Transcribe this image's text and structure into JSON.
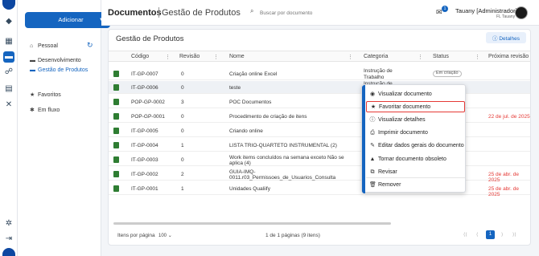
{
  "header": {
    "title": "Documentos",
    "subtitle": "Gestão de Produtos",
    "search_placeholder": "Buscar por documento",
    "notif_count": "1",
    "user_name": "Tauany [Administrador]",
    "user_role": "FL Tauany"
  },
  "sidebar": {
    "add_label": "Adicionar",
    "pessoal": "Pessoal",
    "desenvolvimento": "Desenvolvimento",
    "gestao": "Gestão de Produtos",
    "favoritos": "Favoritos",
    "fluxo": "Em fluxo"
  },
  "panel": {
    "title": "Gestão de Produtos",
    "details_label": "Detalhes"
  },
  "table": {
    "columns": [
      "Código",
      "Revisão",
      "Nome",
      "Categoria",
      "Status",
      "Próxima revisão"
    ],
    "rows": [
      {
        "code": "IT-GP-0007",
        "rev": "0",
        "name": "Criação online Excel",
        "name2": "",
        "cat": "Instrução de",
        "cat2": "Trabalho",
        "status": "Em criação",
        "next": ""
      },
      {
        "code": "IT-GP-0006",
        "rev": "0",
        "name": "teste",
        "name2": "",
        "cat": "Instrução de",
        "cat2": "",
        "status": "",
        "next": ""
      },
      {
        "code": "POP-GP-0002",
        "rev": "3",
        "name": "POC Documentos",
        "name2": "",
        "cat": "",
        "cat2": "",
        "status": "",
        "next": ""
      },
      {
        "code": "POP-GP-0001",
        "rev": "0",
        "name": "Procedimento de criação de itens",
        "name2": "",
        "cat": "",
        "cat2": "",
        "status": "",
        "next": "22 de jul. de 2025"
      },
      {
        "code": "IT-GP-0005",
        "rev": "0",
        "name": "Criando online",
        "name2": "",
        "cat": "",
        "cat2": "",
        "status": "",
        "next": ""
      },
      {
        "code": "IT-GP-0004",
        "rev": "1",
        "name": "LISTA TRIO-QUARTETO INSTRUMENTAL (2)",
        "name2": "",
        "cat": "",
        "cat2": "",
        "status": "",
        "next": ""
      },
      {
        "code": "IT-GP-0003",
        "rev": "0",
        "name": "Work items concluídos na semana exceto Não se",
        "name2": "aplica (4)",
        "cat": "",
        "cat2": "",
        "status": "",
        "next": ""
      },
      {
        "code": "IT-GP-0002",
        "rev": "2",
        "name": "GUIA-IMQ-",
        "name2": "0011.r03_Permissoes_de_Usuarios_Consulta",
        "cat": "",
        "cat2": "",
        "status": "",
        "next": "25 de abr. de 2025"
      },
      {
        "code": "IT-GP-0001",
        "rev": "1",
        "name": "Unidades Qualiify",
        "name2": "",
        "cat": "Trabalho",
        "cat2": "",
        "status": "",
        "next": "25 de abr. de 2025"
      }
    ]
  },
  "footer": {
    "per_page_label": "Itens por página",
    "page_size": "100",
    "page_info": "1 de 1 páginas (9 itens)",
    "current_page": "1"
  },
  "menu": {
    "items": [
      {
        "label": "Visualizar documento",
        "icon": "eye-icon"
      },
      {
        "label": "Favoritar documento",
        "icon": "star-icon"
      },
      {
        "label": "Visualizar detalhes",
        "icon": "info-icon"
      },
      {
        "label": "Imprimir documento",
        "icon": "printer-icon"
      },
      {
        "label": "Editar dados gerais do documento",
        "icon": "pencil-icon"
      },
      {
        "label": "Tornar documento obsoleto",
        "icon": "warning-icon"
      },
      {
        "label": "Revisar",
        "icon": "review-icon"
      },
      {
        "label": "Remover",
        "icon": "trash-icon"
      }
    ]
  },
  "colors": {
    "primary": "#1565c0",
    "highlight_box": "#e53935",
    "date_red": "#e53935",
    "doc_green": "#2e7d32"
  }
}
